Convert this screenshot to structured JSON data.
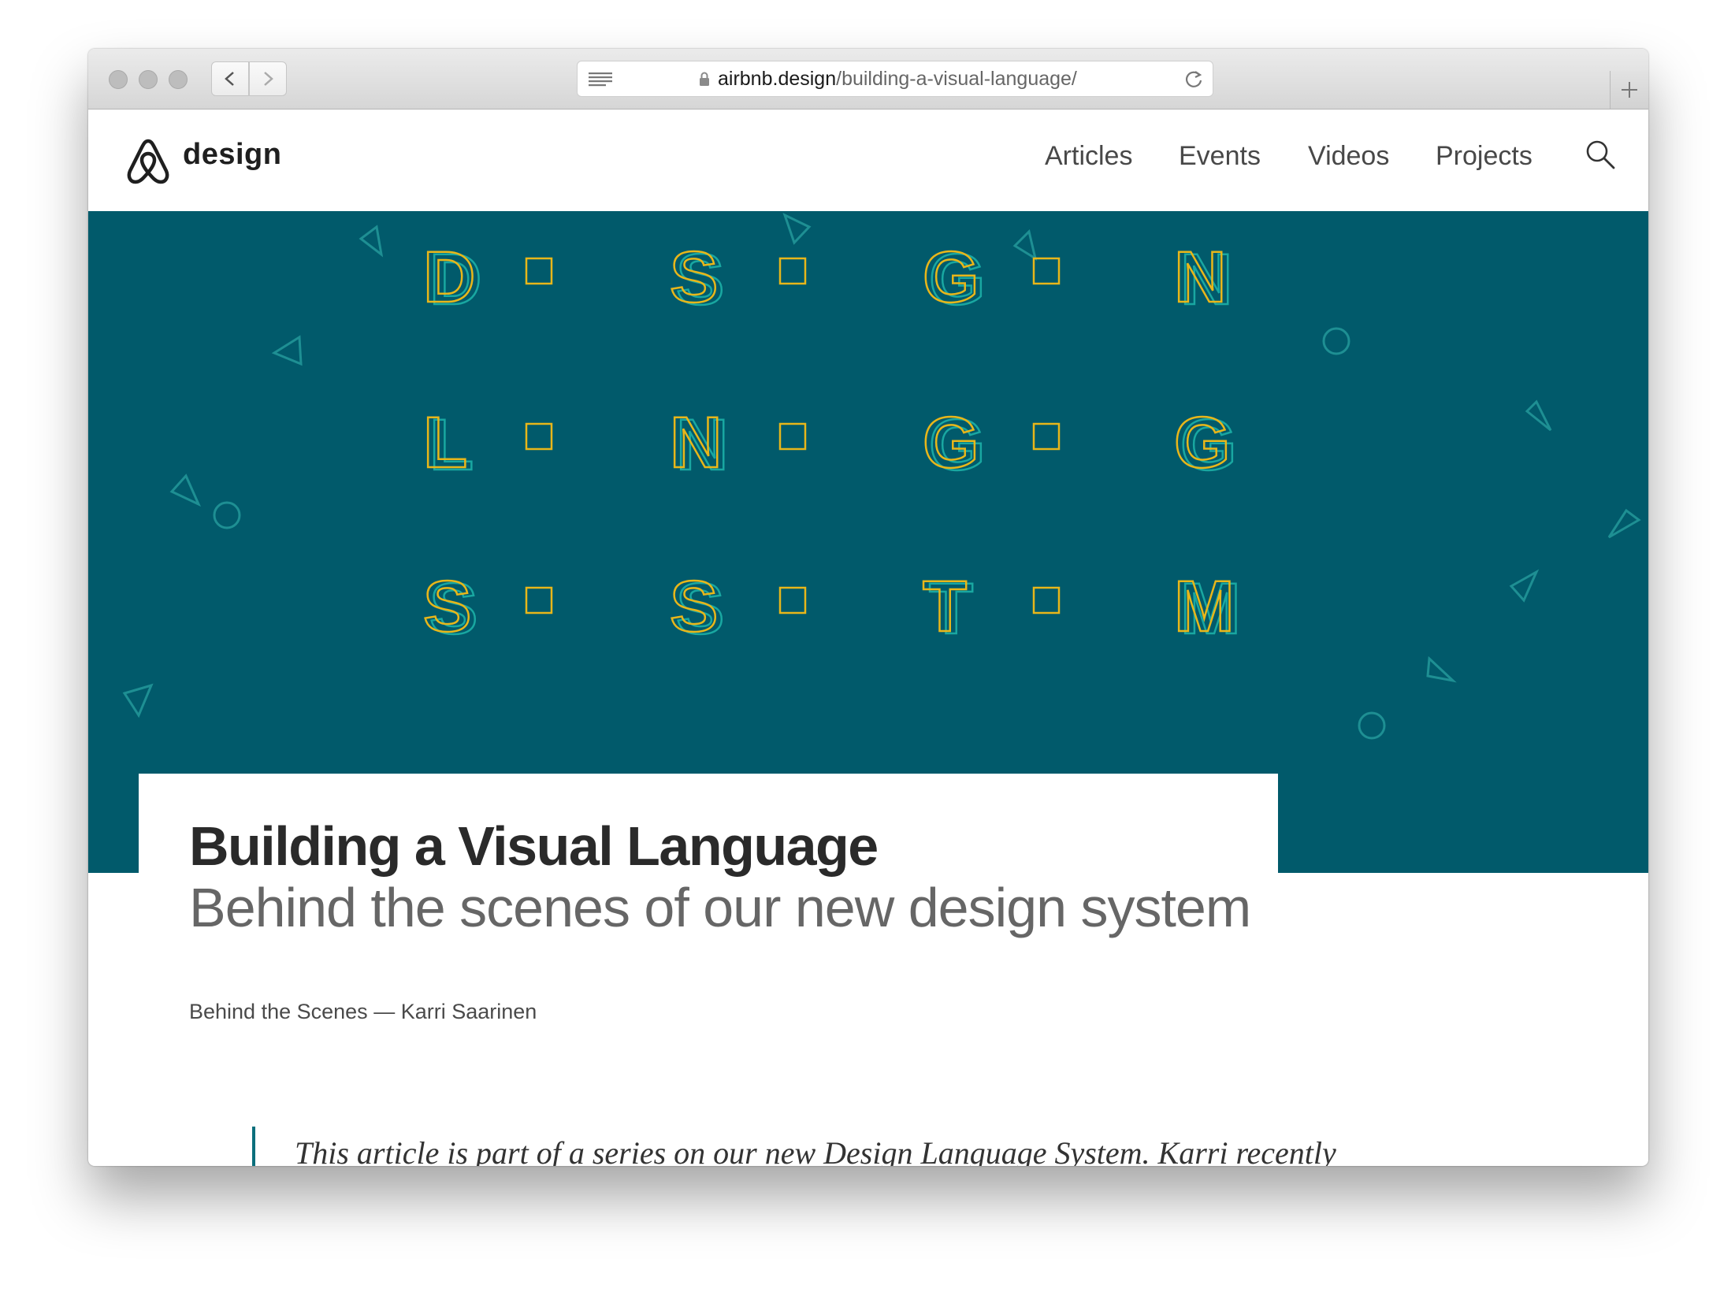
{
  "browser": {
    "url_host": "airbnb.design",
    "url_path": "/building-a-visual-language/"
  },
  "header": {
    "logo_text": "design",
    "nav": [
      "Articles",
      "Events",
      "Videos",
      "Projects"
    ]
  },
  "hero": {
    "rows": [
      [
        "D",
        "S",
        "G",
        "N"
      ],
      [
        "L",
        "N",
        "G",
        "G"
      ],
      [
        "S",
        "S",
        "T",
        "M"
      ]
    ],
    "colors": {
      "background": "#015a6b",
      "letter_outline": "#e8b61a",
      "letter_shadow": "#19a7a1",
      "shapes": "#1e8f93",
      "squares": "#e8b61a"
    }
  },
  "article": {
    "title": "Building a Visual Language",
    "subtitle": "Behind the scenes of our new design system",
    "category": "Behind the Scenes",
    "separator": "—",
    "author": "Karri Saarinen",
    "intro": "This article is part of a series on our new Design Language System. Karri recently"
  },
  "colors": {
    "accent": "#0b6f7c",
    "title": "#2a2a2a",
    "subtitle": "#666666"
  }
}
